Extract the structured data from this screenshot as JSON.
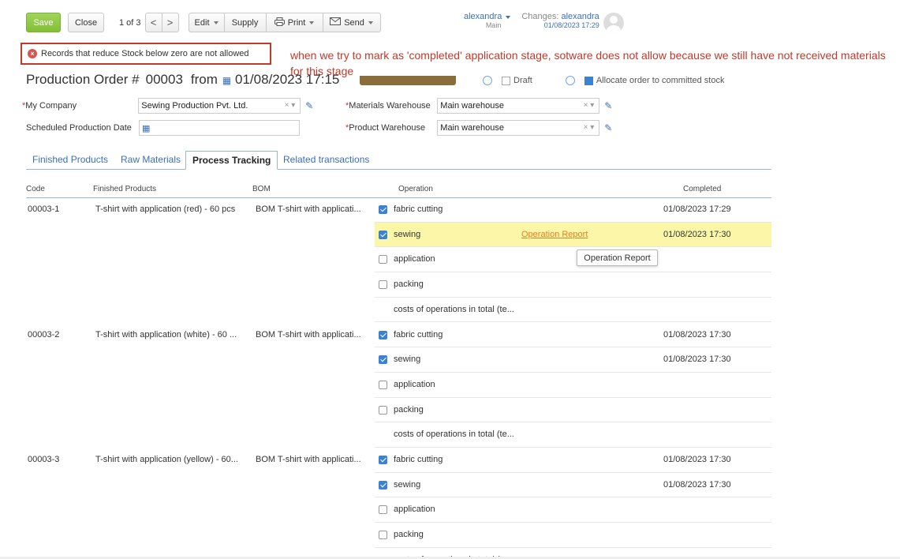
{
  "toolbar": {
    "save": "Save",
    "close": "Close",
    "pager": "1 of 3",
    "prev": "<",
    "next": ">",
    "edit": "Edit",
    "supply": "Supply",
    "print": "Print",
    "send": "Send"
  },
  "user": {
    "name": "alexandra",
    "branch": "Main",
    "changes_label": "Changes:",
    "changes_user": "alexandra",
    "changes_date": "01/08/2023 17:29"
  },
  "error": {
    "text": "Records that reduce Stock below zero are not allowed"
  },
  "annotation": "when we try to mark as 'completed' application stage, sotware does not allow because we still have not received materials for this stage",
  "heading": {
    "title": "Production Order #",
    "number": "00003",
    "from": "from",
    "date": "01/08/2023 17:15",
    "draft": "Draft",
    "allocate": "Allocate order to committed stock"
  },
  "form": {
    "company_label": "My Company",
    "company_value": "Sewing Production Pvt. Ltd.",
    "sched_label": "Scheduled Production Date",
    "sched_value": "",
    "mat_wh_label": "Materials Warehouse",
    "mat_wh_value": "Main warehouse",
    "prod_wh_label": "Product Warehouse",
    "prod_wh_value": "Main warehouse"
  },
  "tabs": [
    "Finished Products",
    "Raw Materials",
    "Process Tracking",
    "Related transactions"
  ],
  "table": {
    "headers": {
      "code": "Code",
      "finished": "Finished Products",
      "bom": "BOM",
      "operation": "Operation",
      "completed": "Completed"
    },
    "groups": [
      {
        "code": "00003-1",
        "product": "T-shirt with application (red) - 60 pcs",
        "bom": "BOM T-shirt with applicati...",
        "ops": [
          {
            "name": "fabric cutting",
            "checked": true,
            "completed": "01/08/2023 17:29"
          },
          {
            "name": "sewing",
            "checked": true,
            "completed": "01/08/2023 17:30",
            "link": "Operation Report"
          },
          {
            "name": "application",
            "checked": false,
            "completed": ""
          },
          {
            "name": "packing",
            "checked": false,
            "completed": ""
          },
          {
            "name": "costs of operations in total (te...",
            "checked": null,
            "completed": ""
          }
        ]
      },
      {
        "code": "00003-2",
        "product": "T-shirt with application (white) - 60 ...",
        "bom": "BOM T-shirt with applicati...",
        "ops": [
          {
            "name": "fabric cutting",
            "checked": true,
            "completed": "01/08/2023 17:30"
          },
          {
            "name": "sewing",
            "checked": true,
            "completed": "01/08/2023 17:30"
          },
          {
            "name": "application",
            "checked": false,
            "completed": ""
          },
          {
            "name": "packing",
            "checked": false,
            "completed": ""
          },
          {
            "name": "costs of operations in total (te...",
            "checked": null,
            "completed": ""
          }
        ]
      },
      {
        "code": "00003-3",
        "product": "T-shirt with application (yellow) - 60...",
        "bom": "BOM T-shirt with applicati...",
        "ops": [
          {
            "name": "fabric cutting",
            "checked": true,
            "completed": "01/08/2023 17:30"
          },
          {
            "name": "sewing",
            "checked": true,
            "completed": "01/08/2023 17:30"
          },
          {
            "name": "application",
            "checked": false,
            "completed": ""
          },
          {
            "name": "packing",
            "checked": false,
            "completed": ""
          },
          {
            "name": "costs of operations in total (te...",
            "checked": null,
            "completed": ""
          }
        ]
      }
    ]
  },
  "tooltip": "Operation Report"
}
